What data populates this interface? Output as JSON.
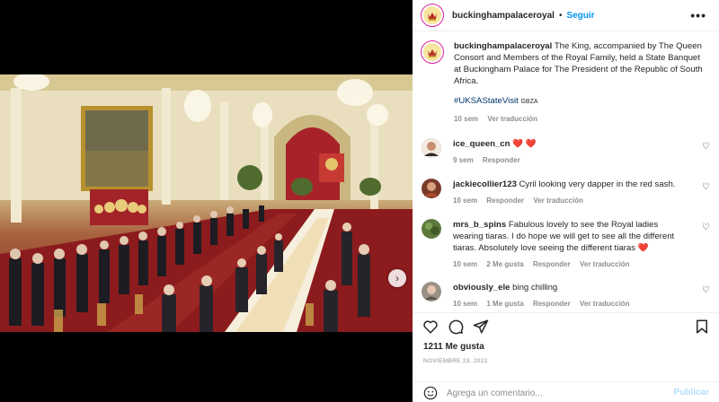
{
  "post": {
    "username": "buckinghampalaceroyal",
    "follow_label": "Seguir",
    "more_label": "•••",
    "dot": "•"
  },
  "caption": {
    "username": "buckinghampalaceroyal",
    "text": "The King, accompanied by The Queen Consort and Members of the Royal Family, held a State Banquet at Buckingham Palace for The President of the Republic of South Africa.",
    "hashtag": "#UKSAStateVisit",
    "tag": "GBZA",
    "time": "10 sem",
    "see_translation": "Ver traducción"
  },
  "comments": [
    {
      "username": "ice_queen_cn",
      "text": "",
      "hearts": "❤️ ❤️",
      "time": "9 sem",
      "likes": "",
      "reply": "Responder",
      "translate": ""
    },
    {
      "username": "jackiecollier123",
      "text": "Cyril looking very dapper in the red sash.",
      "hearts": "",
      "time": "10 sem",
      "likes": "",
      "reply": "Responder",
      "translate": "Ver traducción"
    },
    {
      "username": "mrs_b_spins",
      "text": "Fabulous lovely to see the Royal ladies wearing tiaras. I do hope we will get to see all the different tiaras. Absolutely love seeing the different tiaras",
      "hearts": "❤️",
      "time": "10 sem",
      "likes": "2 Me gusta",
      "reply": "Responder",
      "translate": "Ver traducción"
    },
    {
      "username": "obviously_ele",
      "text": "bing chilling",
      "hearts": "",
      "time": "10 sem",
      "likes": "1 Me gusta",
      "reply": "Responder",
      "translate": "Ver traducción"
    }
  ],
  "likes_count": "1211 Me gusta",
  "post_date": "NOVIEMBRE 23, 2022",
  "add_comment": {
    "placeholder": "Agrega un comentario...",
    "publish_label": "Publicar"
  },
  "colors": {
    "accent": "#0095f6",
    "heart": "#ed4956",
    "muted": "#8e8e8e"
  }
}
